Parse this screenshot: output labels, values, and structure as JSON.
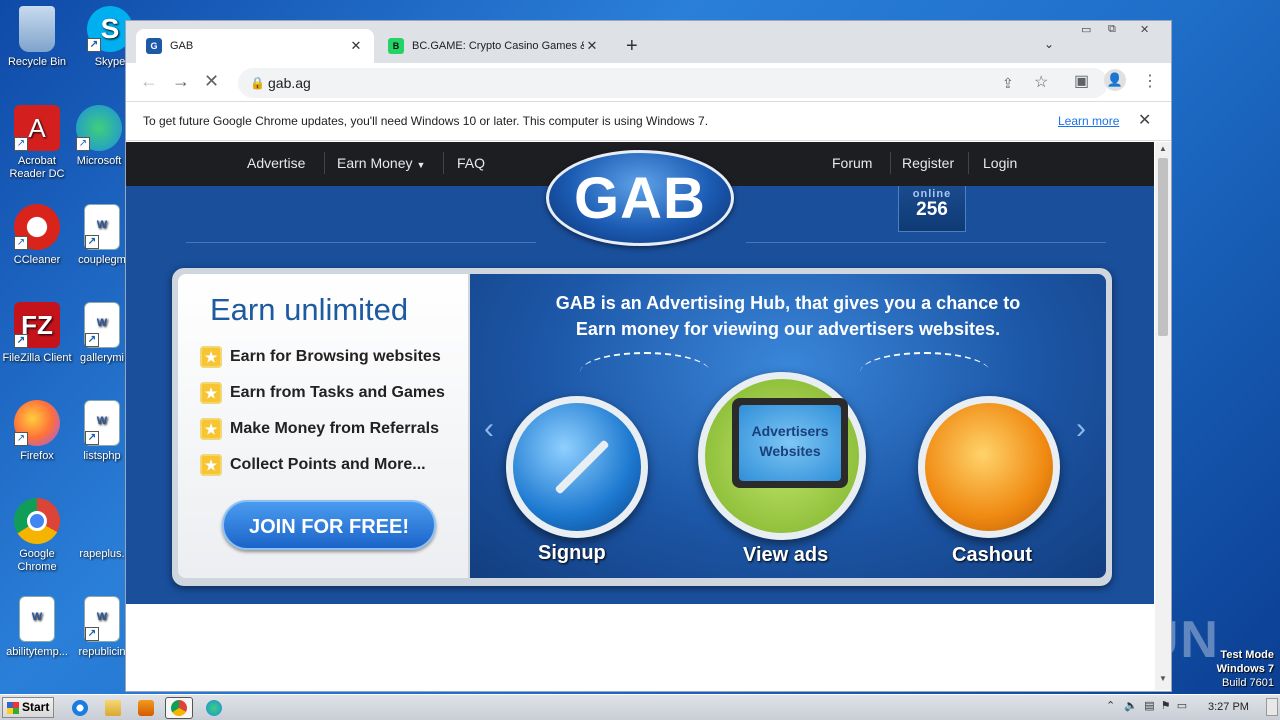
{
  "desktop": {
    "icons": [
      {
        "label": "Recycle Bin",
        "color": "#8fb2d8"
      },
      {
        "label": "Skype",
        "color": "#00aff0"
      },
      {
        "label": "Acrobat Reader DC",
        "color": "#d3201f"
      },
      {
        "label": "Microsoft",
        "color": "#1d8de0"
      },
      {
        "label": "CCleaner",
        "color": "#d9241c"
      },
      {
        "label": "couplegm",
        "color": "#ffffff"
      },
      {
        "label": "FileZilla Client",
        "color": "#c4131b"
      },
      {
        "label": "gallerymi",
        "color": "#ffffff"
      },
      {
        "label": "Firefox",
        "color": "#ff7139"
      },
      {
        "label": "listsphp",
        "color": "#ffffff"
      },
      {
        "label": "Google Chrome",
        "color": "#4285f4"
      },
      {
        "label": "rapeplus.",
        "color": "#1f6fc9"
      },
      {
        "label": "abilitytemp...",
        "color": "#ffffff"
      },
      {
        "label": "republicin",
        "color": "#ffffff"
      }
    ],
    "watermark": "ANY RUN",
    "test_mode": {
      "line1": "Test Mode",
      "line2": "Windows 7",
      "line3": "Build 7601"
    }
  },
  "browser": {
    "tabs": [
      {
        "title": "GAB",
        "favicon": "gab-icon",
        "active": true
      },
      {
        "title": "BC.GAME: Crypto Casino Games & C",
        "favicon": "bcgame-icon",
        "active": false
      }
    ],
    "new_tab": "+",
    "tab_search": "⌄",
    "window_controls": {
      "minimize": "▭",
      "restore": "⧉",
      "close": "✕"
    },
    "address": "gab.ag",
    "infobar": {
      "message": "To get future Google Chrome updates, you'll need Windows 10 or later. This computer is using Windows 7.",
      "link": "Learn more"
    }
  },
  "site": {
    "nav_left": [
      "Advertise",
      "Earn Money",
      "FAQ"
    ],
    "nav_right": [
      "Forum",
      "Register",
      "Login"
    ],
    "logo": "GAB",
    "online_label": "online",
    "online_count": "256",
    "earn_title": "Earn unlimited",
    "features": [
      "Earn for Browsing websites",
      "Earn from Tasks and Games",
      "Make Money from Referrals",
      "Collect Points and More..."
    ],
    "join_button": "JOIN FOR FREE!",
    "hub_line1": "GAB is an Advertising Hub, that gives you a chance to",
    "hub_line2": "Earn money for viewing our advertisers websites.",
    "steps": [
      "Signup",
      "View ads",
      "Cashout"
    ],
    "monitor_text_1": "Advertisers",
    "monitor_text_2": "Websites"
  },
  "taskbar": {
    "start": "Start",
    "clock": "3:27 PM"
  }
}
